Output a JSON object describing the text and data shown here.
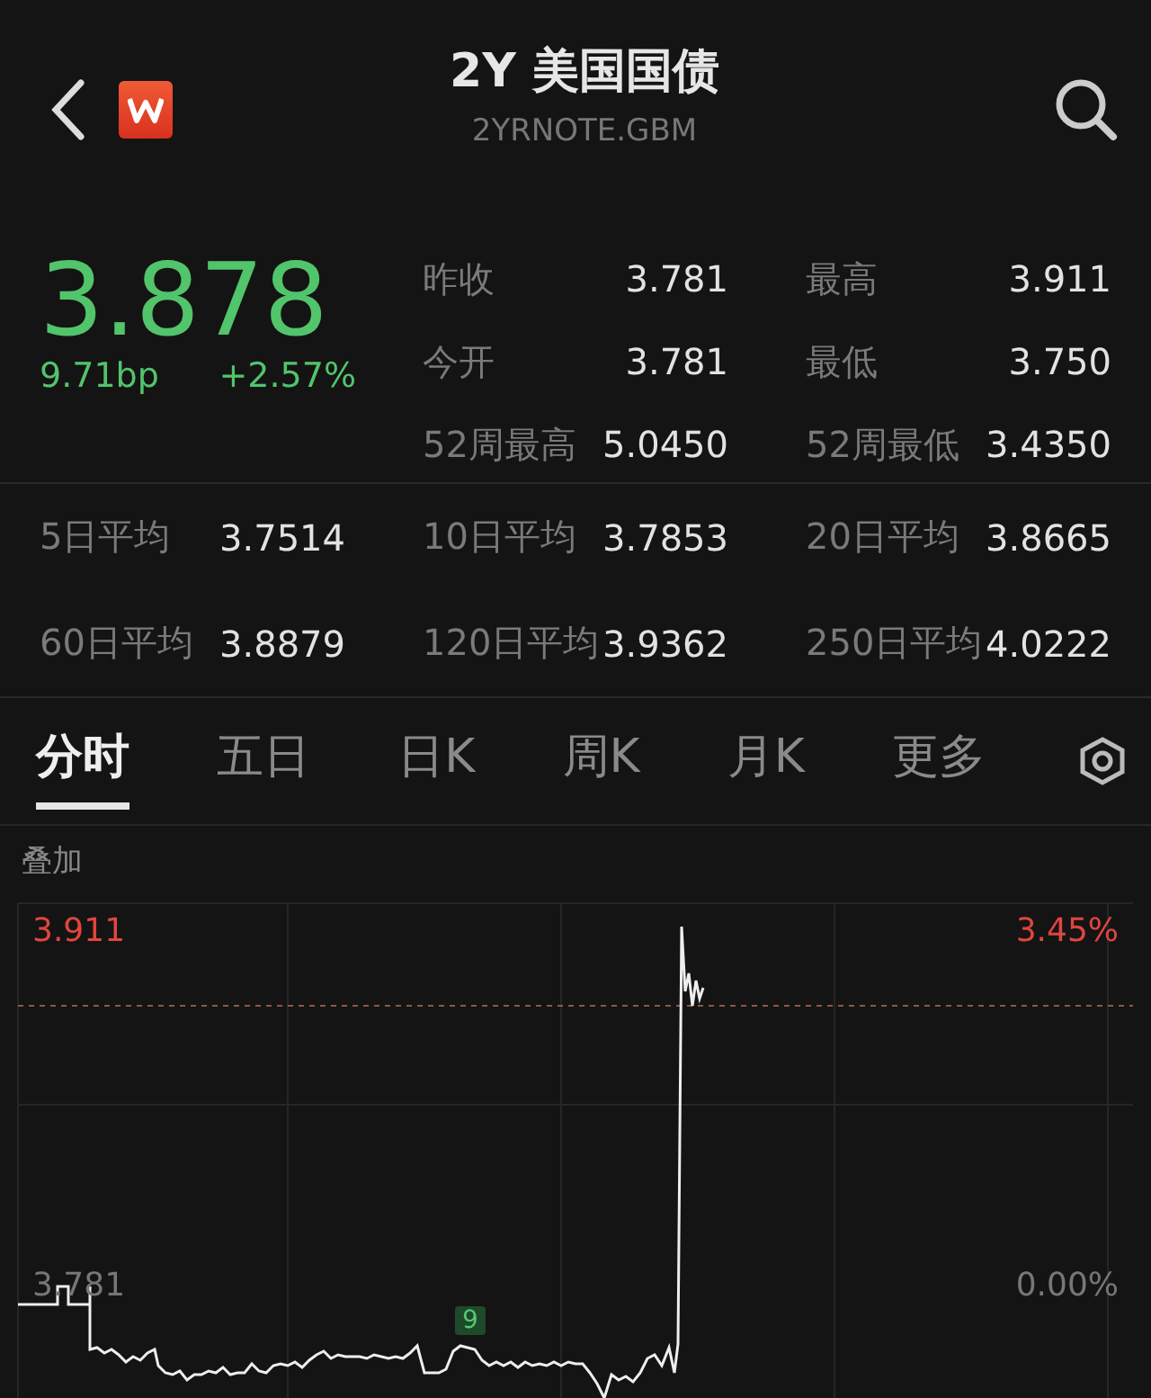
{
  "header": {
    "title": "2Y 美国国债",
    "symbol": "2YRNOTE.GBM"
  },
  "quote": {
    "price": "3.878",
    "change": "9.71bp",
    "change_pct": "+2.57%"
  },
  "stats": [
    {
      "label": "昨收",
      "value": "3.781"
    },
    {
      "label": "最高",
      "value": "3.911"
    },
    {
      "label": "今开",
      "value": "3.781"
    },
    {
      "label": "最低",
      "value": "3.750"
    },
    {
      "label": "52周最高",
      "value": "5.0450"
    },
    {
      "label": "52周最低",
      "value": "3.4350"
    }
  ],
  "averages": [
    {
      "label": "5日平均",
      "value": "3.7514"
    },
    {
      "label": "10日平均",
      "value": "3.7853"
    },
    {
      "label": "20日平均",
      "value": "3.8665"
    },
    {
      "label": "60日平均",
      "value": "3.8879"
    },
    {
      "label": "120日平均",
      "value": "3.9362"
    },
    {
      "label": "250日平均",
      "value": "4.0222"
    }
  ],
  "tabs": [
    {
      "label": "分时",
      "selected": true
    },
    {
      "label": "五日",
      "selected": false
    },
    {
      "label": "日K",
      "selected": false
    },
    {
      "label": "周K",
      "selected": false
    },
    {
      "label": "月K",
      "selected": false
    },
    {
      "label": "更多",
      "selected": false
    }
  ],
  "overlay_label": "叠加",
  "chart": {
    "high_value": "3.911",
    "high_pct": "3.45%",
    "base_value": "3.781",
    "base_pct": "0.00%",
    "marker": "9"
  }
}
